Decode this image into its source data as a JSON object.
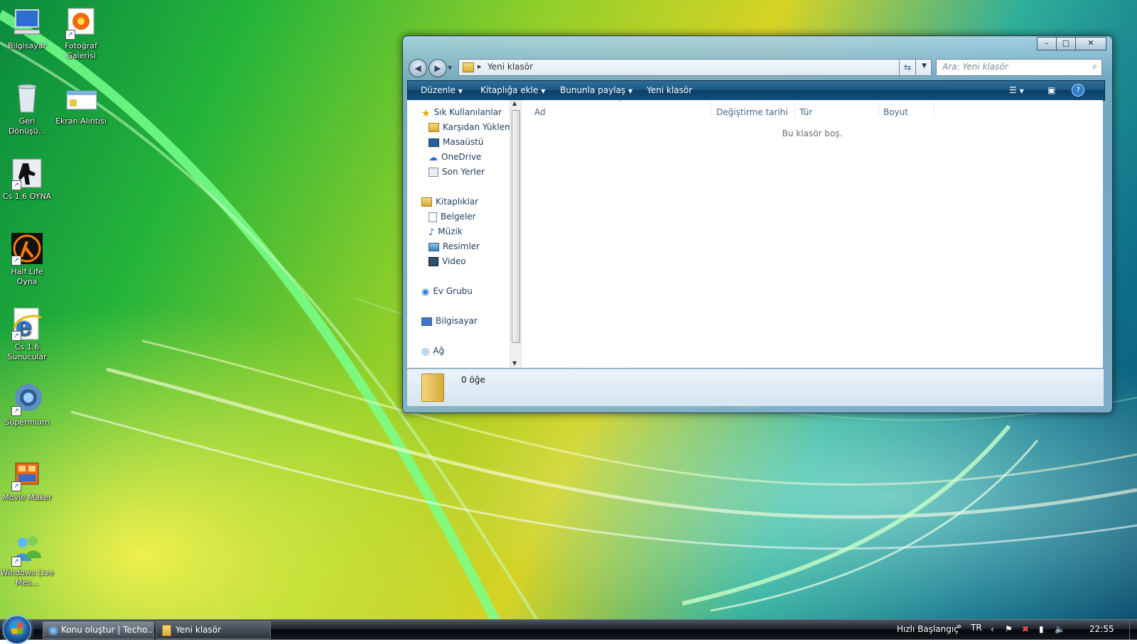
{
  "desktop": {
    "icons": [
      {
        "label": "Bilgisayar",
        "icon": "computer-icon"
      },
      {
        "label": "Fotoğraf Galerisi",
        "icon": "photo-gallery-icon"
      },
      {
        "label": "Geri Dönüşü...",
        "icon": "recycle-bin-icon"
      },
      {
        "label": "Ekran Alıntısı",
        "icon": "snipping-tool-icon"
      },
      {
        "label": "Cs 1.6 OYNA",
        "icon": "counter-strike-icon"
      },
      {
        "label": "Half Life Oyna",
        "icon": "half-life-icon"
      },
      {
        "label": "Cs 1.6 Sunucular",
        "icon": "internet-explorer-icon"
      },
      {
        "label": "Supermium",
        "icon": "supermium-browser-icon"
      },
      {
        "label": "Movie Maker",
        "icon": "movie-maker-icon"
      },
      {
        "label": "Windows Live Mes...",
        "icon": "windows-live-messenger-icon"
      }
    ]
  },
  "window": {
    "caption_buttons": {
      "minimize": "–",
      "maximize": "□",
      "close": "✕"
    },
    "address": {
      "path": "Yeni klasör",
      "separator": "▸"
    },
    "search": {
      "placeholder": "Ara: Yeni klasör"
    },
    "toolbar": {
      "organize": "Düzenle",
      "add_to_library": "Kitaplığa ekle",
      "share_with": "Bununla paylaş",
      "new_folder": "Yeni klasör"
    },
    "nav": {
      "favorites": "Sık Kullanılanlar",
      "favorites_items": [
        "Karşıdan Yüklem",
        "Masaüstü",
        "OneDrive",
        "Son Yerler"
      ],
      "libraries": "Kitaplıklar",
      "library_items": [
        "Belgeler",
        "Müzik",
        "Resimler",
        "Video"
      ],
      "homegroup": "Ev Grubu",
      "computer": "Bilgisayar",
      "network": "Ağ"
    },
    "columns": [
      "Ad",
      "Değiştirme tarihi",
      "Tür",
      "Boyut"
    ],
    "empty_message": "Bu klasör boş.",
    "details": {
      "item_count": "0 öğe"
    }
  },
  "taskbar": {
    "tasks": [
      {
        "label": "Konu oluştur | Techo...",
        "icon": "browser-icon"
      },
      {
        "label": "Yeni klasör",
        "icon": "folder-icon"
      }
    ],
    "quick_launch": "Hızlı Başlangıç",
    "chevron": "»",
    "language": "TR",
    "time": "22:55"
  },
  "colors": {
    "toolbar": "#1d5a86",
    "nav_text": "#1e395b",
    "taskbar": "#1d232a"
  }
}
